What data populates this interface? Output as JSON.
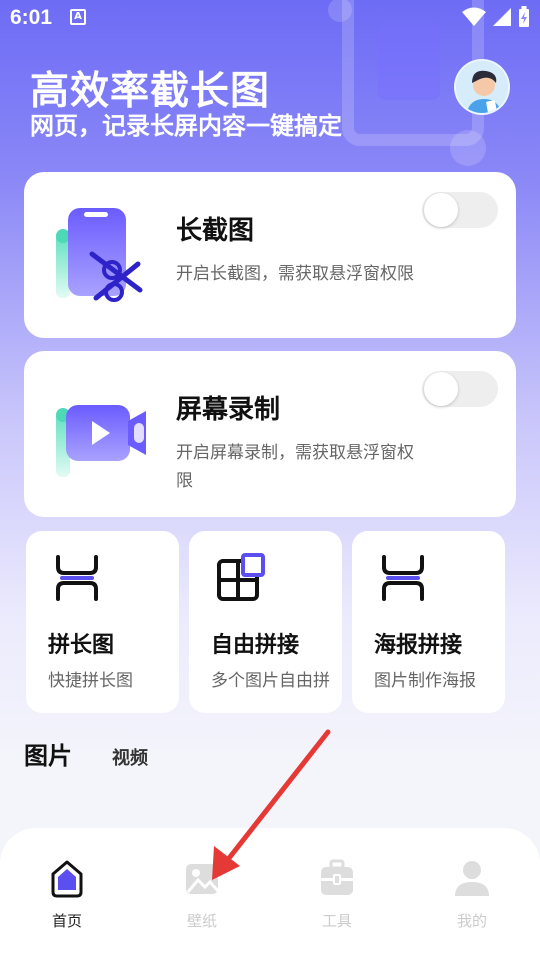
{
  "status_bar": {
    "time": "6:01",
    "notification_badge": "A"
  },
  "hero": {
    "title": "高效率截长图",
    "subtitle": "网页，记录长屏内容一键搞定"
  },
  "cards": [
    {
      "title": "长截图",
      "desc": "开启长截图，需获取悬浮窗权限",
      "enabled": false,
      "icon": "scissors-phone-icon"
    },
    {
      "title": "屏幕录制",
      "desc": "开启屏幕录制，需获取悬浮窗权限",
      "enabled": false,
      "icon": "video-camera-icon"
    }
  ],
  "tools": [
    {
      "title": "拼长图",
      "desc": "快捷拼长图",
      "icon": "stitch-icon"
    },
    {
      "title": "自由拼接",
      "desc": "多个图片自由拼",
      "icon": "grid-icon"
    },
    {
      "title": "海报拼接",
      "desc": "图片制作海报",
      "icon": "stitch-icon"
    }
  ],
  "tabs": {
    "active": "图片",
    "other": "视频"
  },
  "nav": [
    {
      "label": "首页",
      "icon": "home-icon",
      "active": true
    },
    {
      "label": "壁纸",
      "icon": "image-icon",
      "active": false
    },
    {
      "label": "工具",
      "icon": "toolbox-icon",
      "active": false
    },
    {
      "label": "我的",
      "icon": "user-icon",
      "active": false
    }
  ],
  "colors": {
    "accent": "#5b4ff0",
    "background_top": "#6d6cf5",
    "annotation_arrow": "#e53935"
  }
}
